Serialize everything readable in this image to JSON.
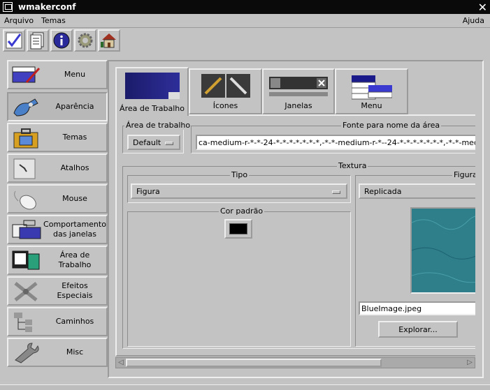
{
  "window": {
    "title": "wmakerconf"
  },
  "menubar": {
    "file": "Arquivo",
    "themes": "Temas",
    "help": "Ajuda"
  },
  "toolbar": {
    "icons": [
      "check-icon",
      "document-icon",
      "info-icon",
      "gear-icon",
      "home-icon"
    ]
  },
  "sidebar": {
    "items": [
      {
        "label": "Menu",
        "icon": "menu-icon"
      },
      {
        "label": "Aparência",
        "icon": "appearance-icon"
      },
      {
        "label": "Temas",
        "icon": "themes-icon"
      },
      {
        "label": "Atalhos",
        "icon": "shortcuts-icon"
      },
      {
        "label": "Mouse",
        "icon": "mouse-icon"
      },
      {
        "label": "Comportamento das janelas",
        "icon": "window-behavior-icon"
      },
      {
        "label": "Área de Trabalho",
        "icon": "workspace-icon"
      },
      {
        "label": "Efeitos Especiais",
        "icon": "special-effects-icon"
      },
      {
        "label": "Caminhos",
        "icon": "paths-icon"
      },
      {
        "label": "Misc",
        "icon": "misc-icon"
      }
    ]
  },
  "tabs": [
    {
      "label": "Área de Trabalho"
    },
    {
      "label": "Ícones"
    },
    {
      "label": "Janelas"
    },
    {
      "label": "Menu"
    }
  ],
  "workspace": {
    "group_title": "Área de trabalho",
    "selected": "Default"
  },
  "font": {
    "group_title": "Fonte para nome da área",
    "value": "ca-medium-r-*-*-24-*-*-*-*-*-*-*,-*-*-medium-r-*--24-*-*-*-*-*-*-*,-*-*-medium-r-"
  },
  "texture": {
    "group_title": "Textura",
    "type_title": "Tipo",
    "type_value": "Figura",
    "color_title": "Cor padrão",
    "image_title": "Figura",
    "mode_value": "Replicada",
    "file_name": "BlueImage.jpeg",
    "browse_label": "Explorar..."
  },
  "colors": {
    "default_color": "#000000",
    "preview_color": "#2e7f8a"
  }
}
